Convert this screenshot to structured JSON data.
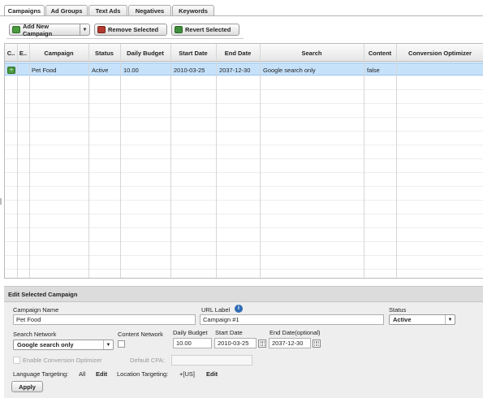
{
  "tabs": [
    {
      "label": "Campaigns",
      "active": true
    },
    {
      "label": "Ad Groups",
      "active": false
    },
    {
      "label": "Text Ads",
      "active": false
    },
    {
      "label": "Negatives",
      "active": false
    },
    {
      "label": "Keywords",
      "active": false
    }
  ],
  "toolbar": {
    "add_label": "Add New Campaign",
    "remove_label": "Remove Selected",
    "revert_label": "Revert Selected"
  },
  "grid": {
    "columns": [
      "C..",
      "E..",
      "Campaign",
      "Status",
      "Daily Budget",
      "Start Date",
      "End Date",
      "Search",
      "Content",
      "Conversion Optimizer"
    ],
    "rows": [
      {
        "campaign": "Pet Food",
        "status": "Active",
        "daily_budget": "10.00",
        "start_date": "2010-03-25",
        "end_date": "2037-12-30",
        "search": "Google search only",
        "content": "false",
        "conversion_optimizer": ""
      }
    ]
  },
  "edit": {
    "title": "Edit Selected Campaign",
    "campaign_name_label": "Campaign Name",
    "campaign_name_value": "Pet Food",
    "url_label_label": "URL Label",
    "url_label_value": "Campaign #1",
    "status_label": "Status",
    "status_value": "Active",
    "search_network_label": "Search Network",
    "search_network_value": "Google search only",
    "content_network_label": "Content Network",
    "daily_budget_label": "Daily Budget",
    "daily_budget_value": "10.00",
    "start_date_label": "Start Date",
    "start_date_value": "2010-03-25",
    "end_date_label": "End Date(optional)",
    "end_date_value": "2037-12-30",
    "enable_optimizer_label": "Enable Conversion Optimizer",
    "default_cpa_label": "Default CPA:",
    "language_targeting_label": "Language Targeting:",
    "language_targeting_value": "All",
    "location_targeting_label": "Location Targeting:",
    "location_targeting_value": "+[US]",
    "edit_link": "Edit",
    "apply_label": "Apply"
  },
  "colors": {
    "selected_row": "#c6e2fb",
    "panel_bg": "#eeeeee",
    "info_icon": "#2f6db5",
    "add_icon": "#4a9a3e"
  }
}
